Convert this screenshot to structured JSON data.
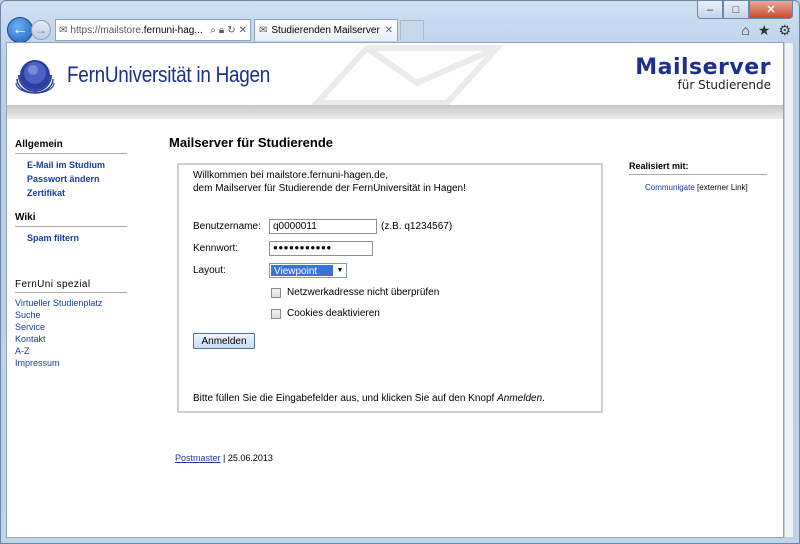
{
  "browser": {
    "url_prefix": "https://mailstore.",
    "url_domain": "fernuni-hag...",
    "tab_title": "Studierenden Mailserver - F...",
    "tab_close": "✕",
    "addr_close": "✕"
  },
  "header": {
    "logo_text": "FernUniversität in Hagen",
    "title": "Mailserver",
    "subtitle": "für Studierende"
  },
  "leftnav": {
    "sections": [
      {
        "title": "Allgemein",
        "items": [
          "E-Mail im Studium",
          "Passwort ändern",
          "Zertifikat"
        ]
      },
      {
        "title": "Wiki",
        "items": [
          "Spam filtern"
        ]
      }
    ],
    "special_title": "FernUni spezial",
    "special_items": [
      "Virtueller Studienplatz",
      "Suche",
      "Service",
      "Kontakt",
      "A-Z",
      "Impressum"
    ]
  },
  "main": {
    "title": "Mailserver für Studierende",
    "intro_line1": "Willkommen bei mailstore.fernuni-hagen.de,",
    "intro_line2": "dem Mailserver für Studierende der FernUniversität in Hagen!",
    "username_label": "Benutzername:",
    "username_value": "q0000011",
    "username_hint": "(z.B. q1234567)",
    "password_label": "Kennwort:",
    "password_value": "●●●●●●●●●●●",
    "layout_label": "Layout:",
    "layout_value": "Viewpoint",
    "check_network": "Netzwerkadresse nicht überprüfen",
    "check_cookies": "Cookies deaktivieren",
    "submit_label": "Anmelden",
    "footer_text": "Bitte füllen Sie die Eingabefelder aus, und klicken Sie auf den Knopf",
    "footer_em": "Anmelden",
    "footer_end": "."
  },
  "right": {
    "title": "Realisiert mit:",
    "link": "Communigate",
    "link_note": "[externer Link]"
  },
  "footer": {
    "postmaster": "Postmaster",
    "date": "| 25.06.2013"
  }
}
